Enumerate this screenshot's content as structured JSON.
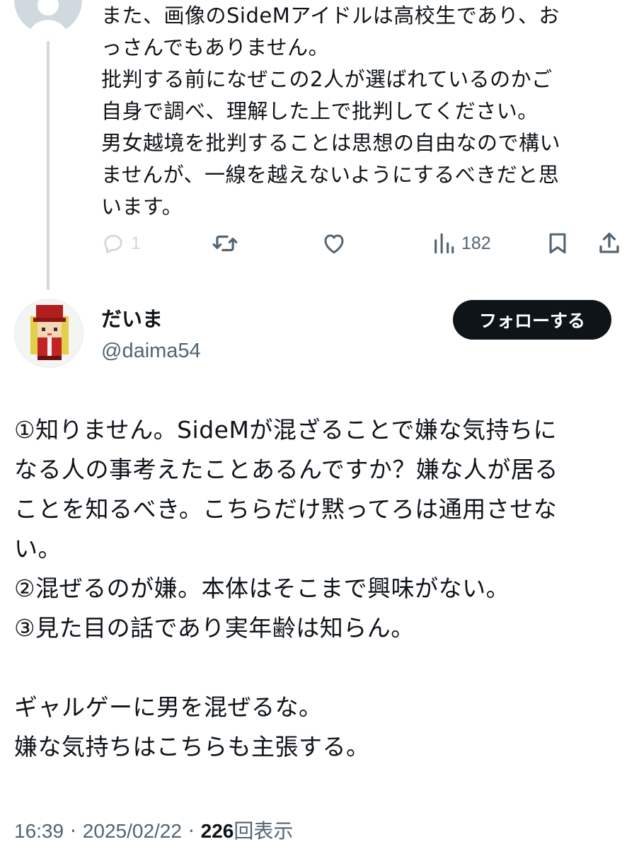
{
  "parent_tweet": {
    "text_lines": [
      "また、画像のSideMアイドルは高校生であり、お",
      "っさんでもありません。",
      "批判する前になぜこの2人が選ばれているのかご",
      "自身で調べ、理解した上で批判してください。",
      "男女越境を批判することは思想の自由なので構い",
      "ませんが、一線を越えないようにするべきだと思",
      "います。"
    ],
    "actions": {
      "reply_count": "1",
      "views_count": "182"
    },
    "icons": [
      "reply-icon",
      "retweet-icon",
      "like-icon",
      "views-icon",
      "bookmark-icon",
      "share-icon"
    ]
  },
  "main_tweet": {
    "display_name": "だいま",
    "handle": "@daima54",
    "follow_label": "フォローする",
    "text_lines": [
      "①知りません。SideMが混ざることで嫌な気持ちに",
      "なる人の事考えたことあるんですか？嫌な人が居る",
      "ことを知るべき。こちらだけ黙ってろは通用させな",
      "い。",
      "②混ぜるのが嫌。本体はそこまで興味がない。",
      "③見た目の話であり実年齢は知らん。",
      "",
      "ギャルゲーに男を混ぜるな。",
      "嫌な気持ちはこちらも主張する。"
    ],
    "time": "16:39",
    "separator": "·",
    "date": "2025/02/22",
    "views_count": "226",
    "views_label": "回表示"
  },
  "colors": {
    "text": "#0f1419",
    "secondary": "#536471",
    "thread_line": "#cfd9de",
    "follow_button_bg": "#0f1419",
    "follow_button_text": "#ffffff"
  }
}
